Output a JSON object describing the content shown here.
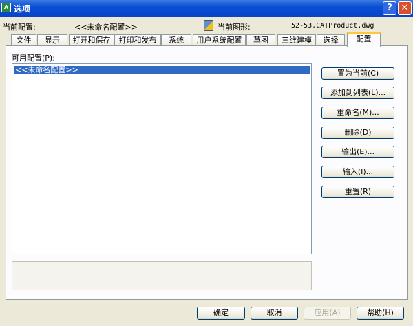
{
  "window": {
    "title": "选项",
    "app_icon": "A",
    "help": "?",
    "close": "✕"
  },
  "header": {
    "current_profile_label": "当前配置:",
    "current_profile": "<<未命名配置>>",
    "current_drawing_label": "当前图形:",
    "current_drawing": "52-53.CATProduct.dwg"
  },
  "tabs": [
    "文件",
    "显示",
    "打开和保存",
    "打印和发布",
    "系统",
    "用户系统配置",
    "草图",
    "三维建模",
    "选择",
    "配置"
  ],
  "profiles": {
    "label": "可用配置(P):",
    "items": [
      "<<未命名配置>>"
    ]
  },
  "side_buttons": [
    "置为当前(C)",
    "添加到列表(L)...",
    "重命名(M)...",
    "删除(D)",
    "输出(E)...",
    "输入(I)...",
    "重置(R)"
  ],
  "footer": {
    "ok": "确定",
    "cancel": "取消",
    "apply": "应用(A)",
    "help": "帮助(H)"
  }
}
